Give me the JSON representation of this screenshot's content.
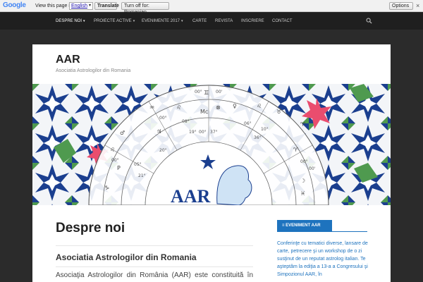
{
  "translate_bar": {
    "logo": "Google",
    "prompt": "View this page in:",
    "language": "English",
    "translate_button": "Translate",
    "turn_off_button": "Turn off for: Romanian",
    "options_button": "Options",
    "close_glyph": "×"
  },
  "nav": {
    "items": [
      {
        "label": "DESPRE NOI",
        "dropdown": "▾"
      },
      {
        "label": "PROIECTE ACTIVE",
        "dropdown": "▾"
      },
      {
        "label": "EVENIMENTE 2017",
        "dropdown": "▾"
      },
      {
        "label": "CARTE",
        "dropdown": ""
      },
      {
        "label": "REVISTA",
        "dropdown": ""
      },
      {
        "label": "INSCRIERE",
        "dropdown": ""
      },
      {
        "label": "CONTACT",
        "dropdown": ""
      }
    ],
    "search_icon": "search-icon"
  },
  "site": {
    "title": "AAR",
    "tagline": "Asociatia Astrologilor din Romania"
  },
  "banner": {
    "logo_text": "AAR"
  },
  "main": {
    "page_title": "Despre noi",
    "section_title": "Asociatia Astrologilor din Romania",
    "body_text": "Asociaţia Astrologilor din România (AAR) este constituită în"
  },
  "sidebar": {
    "widget_title": "≡ EVENIMENT AAR",
    "widget_text": "Conferinţe cu tematici diverse, lansare de carte, petrecere şi un workshop de o zi susţinut de un reputat astrolog italian. Te aşteptăm la ediţia a 13-a a Congresului şi Simpozionul AAR, în"
  },
  "colors": {
    "nav_bg": "#1f1f1f",
    "page_bg": "#2b2b2b",
    "accent_blue": "#1e73be",
    "tile_navy": "#1b3f8f",
    "tile_green": "#4f9a4f",
    "star_pink": "#ea4d6e"
  }
}
